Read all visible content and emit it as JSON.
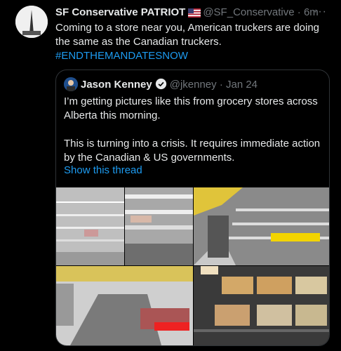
{
  "tweet": {
    "author_name": "SF Conservative PATRIOT",
    "author_handle": "@SF_Conservative",
    "time": "· 6m",
    "more": "···",
    "text": "Coming to a store near you, American truckers are doing the same as the Canadian truckers.",
    "hashtag": "#ENDTHEMANDATESNOW"
  },
  "quote": {
    "author_name": "Jason Kenney",
    "author_handle": "@jkenney",
    "time": "· Jan 24",
    "text_1": "I’m getting pictures like this from grocery stores across Alberta this morning.",
    "text_2": "This is turning into a crisis. It requires immediate action by the Canadian & US governments.",
    "show_thread": "Show this thread"
  },
  "colors": {
    "background": "#000000",
    "text": "#e7e9ea",
    "muted": "#71767b",
    "link": "#1d9bf0",
    "border": "#2f3336"
  },
  "icons": [
    "us-flag-icon",
    "verified-badge-icon",
    "more-options-icon"
  ]
}
